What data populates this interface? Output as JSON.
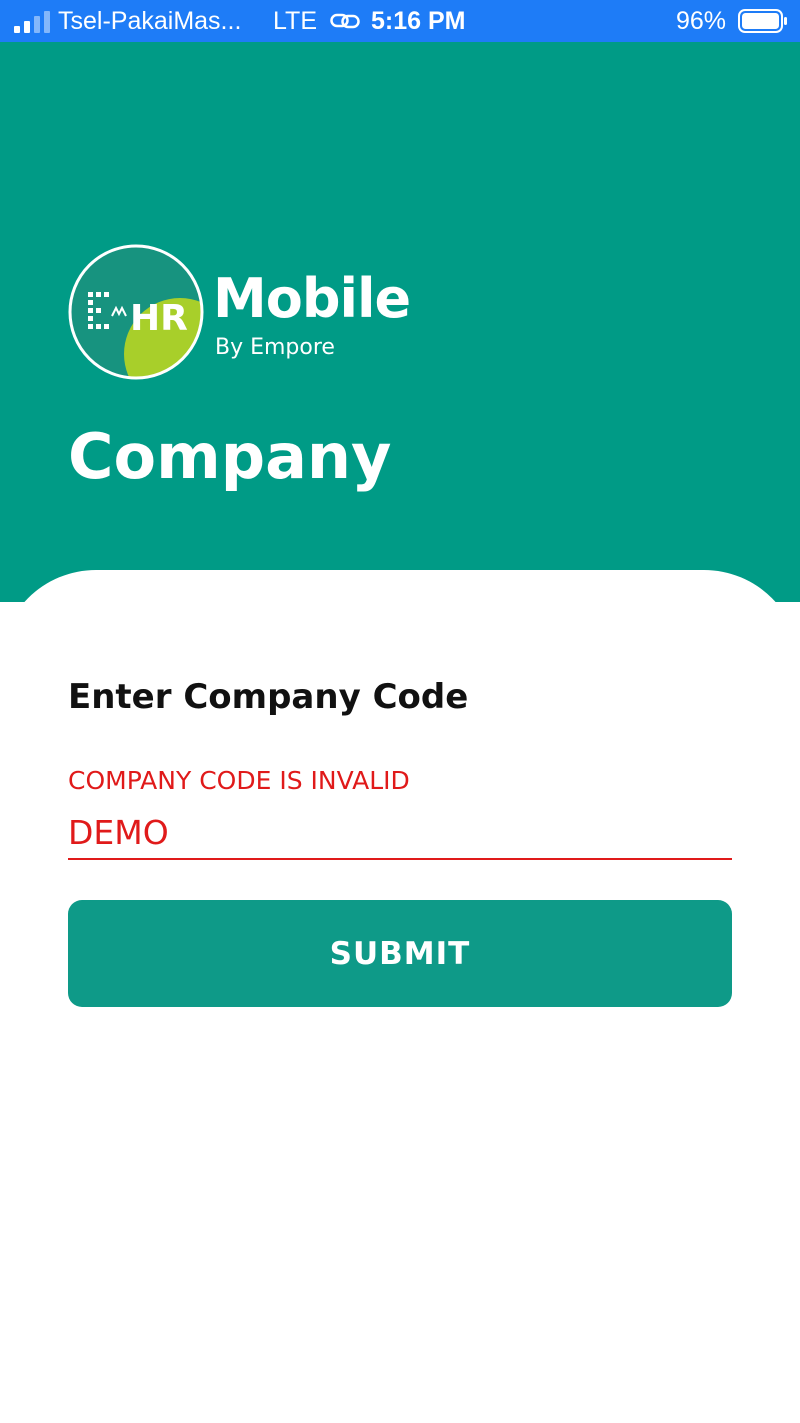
{
  "status_bar": {
    "carrier": "Tsel-PakaiMas...",
    "network": "LTE",
    "time": "5:16 PM",
    "battery_percent": "96%"
  },
  "brand": {
    "badge_text": "E HR",
    "app_name": "Mobile",
    "by_line": "By Empore"
  },
  "page": {
    "title": "Company"
  },
  "form": {
    "heading": "Enter Company Code",
    "error_message": "COMPANY CODE IS INVALID",
    "company_code_value": "DEMO",
    "submit_label": "SUBMIT"
  },
  "colors": {
    "status_bar": "#1e7cf7",
    "header": "#009b86",
    "button": "#0e9a88",
    "error": "#e01a1a",
    "logo_accent": "#a8cf2a"
  }
}
